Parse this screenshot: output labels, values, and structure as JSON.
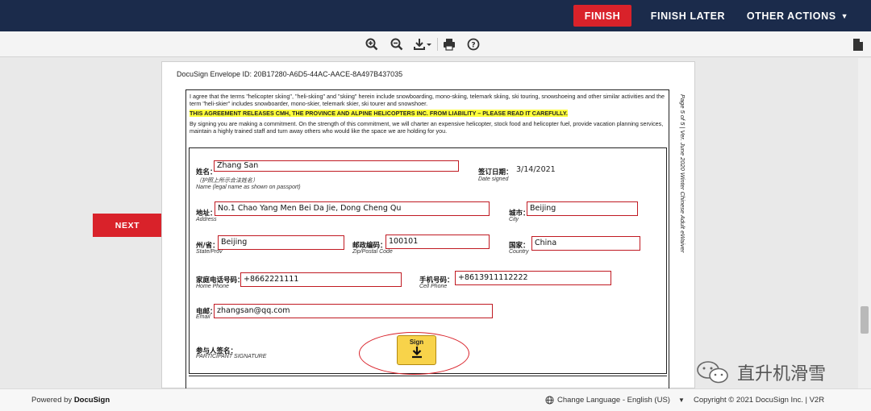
{
  "topbar": {
    "finish_label": "FINISH",
    "finish_later_label": "FINISH LATER",
    "other_actions_label": "OTHER ACTIONS"
  },
  "toolbar": {
    "icons": [
      "zoom-in-icon",
      "zoom-out-icon",
      "download-icon",
      "print-icon",
      "help-icon",
      "document-icon"
    ]
  },
  "navigation": {
    "next_label": "NEXT"
  },
  "document": {
    "envelope_id": "DocuSign Envelope ID: 20B17280-A6D5-44AC-AACE-8A497B437035",
    "side_text": "Page 5 of 5 | Ver. June 2020 Winter Chinese Adult eWaiver",
    "paragraph1": "I agree that the terms \"helicopter skiing\", \"heli-skiing\" and \"skiing\" herein include snowboarding, mono-skiing, telemark skiing, ski touring, snowshoeing and other similar activities and the term \"heli-skier\" includes snowboarder, mono-skier, telemark skier, ski tourer and snowshoer.",
    "paragraph2": "THIS AGREEMENT RELEASES CMH, THE PROVINCE AND ALPINE HELICOPTERS INC. FROM LIABILITY – PLEASE READ IT CAREFULLY.",
    "paragraph3": "By signing you are making a commitment. On the strength of this commitment, we will charter an expensive helicopter, stock food and helicopter fuel, provide vacation planning services, maintain a highly trained staff and turn away others who would like the space we are holding for you.",
    "form": {
      "name_cn": "姓名：",
      "name_cn_note": "（护照上所示合法姓名）",
      "name_en": "Name (legal name as shown on passport)",
      "name_value": "Zhang  San",
      "date_cn": "签订日期：",
      "date_en": "Date signed",
      "date_value": "3/14/2021",
      "address_cn": "地址：",
      "address_en": "Address",
      "address_value": "No.1 Chao Yang Men Bei Da Jie, Dong Cheng Qu",
      "city_cn": "城市：",
      "city_en": "City",
      "city_value": "Beijing",
      "state_cn": "州/省：",
      "state_en": "State/Prov",
      "state_value": "Beijing",
      "zip_cn": "邮政编码：",
      "zip_en": "Zip/Postal Code",
      "zip_value": "100101",
      "country_cn": "国家：",
      "country_en": "Country",
      "country_value": "China",
      "home_phone_cn": "家庭电话号码：",
      "home_phone_en": "Home Phone",
      "home_phone_value": "+8662221111",
      "cell_phone_cn": "手机号码：",
      "cell_phone_en": "Cell Phone",
      "cell_phone_value": "+8613911112222",
      "email_cn": "电邮：",
      "email_en": "Email",
      "email_value": "zhangsan@qq.com",
      "signature_cn": "参与人签名：",
      "signature_en": "PARTICIPANT SIGNATURE",
      "sign_label": "Sign"
    }
  },
  "footer": {
    "powered_by": "Powered by",
    "brand": "DocuSign",
    "change_language": "Change Language - English (US)",
    "copyright": "Copyright © 2021 DocuSign Inc.  |  V2R"
  },
  "watermark": {
    "text": "直升机滑雪"
  },
  "colors": {
    "topbar_bg": "#1b2b4b",
    "accent_red": "#d9222a",
    "sign_yellow": "#f8d34a",
    "field_border": "#c01a22"
  }
}
